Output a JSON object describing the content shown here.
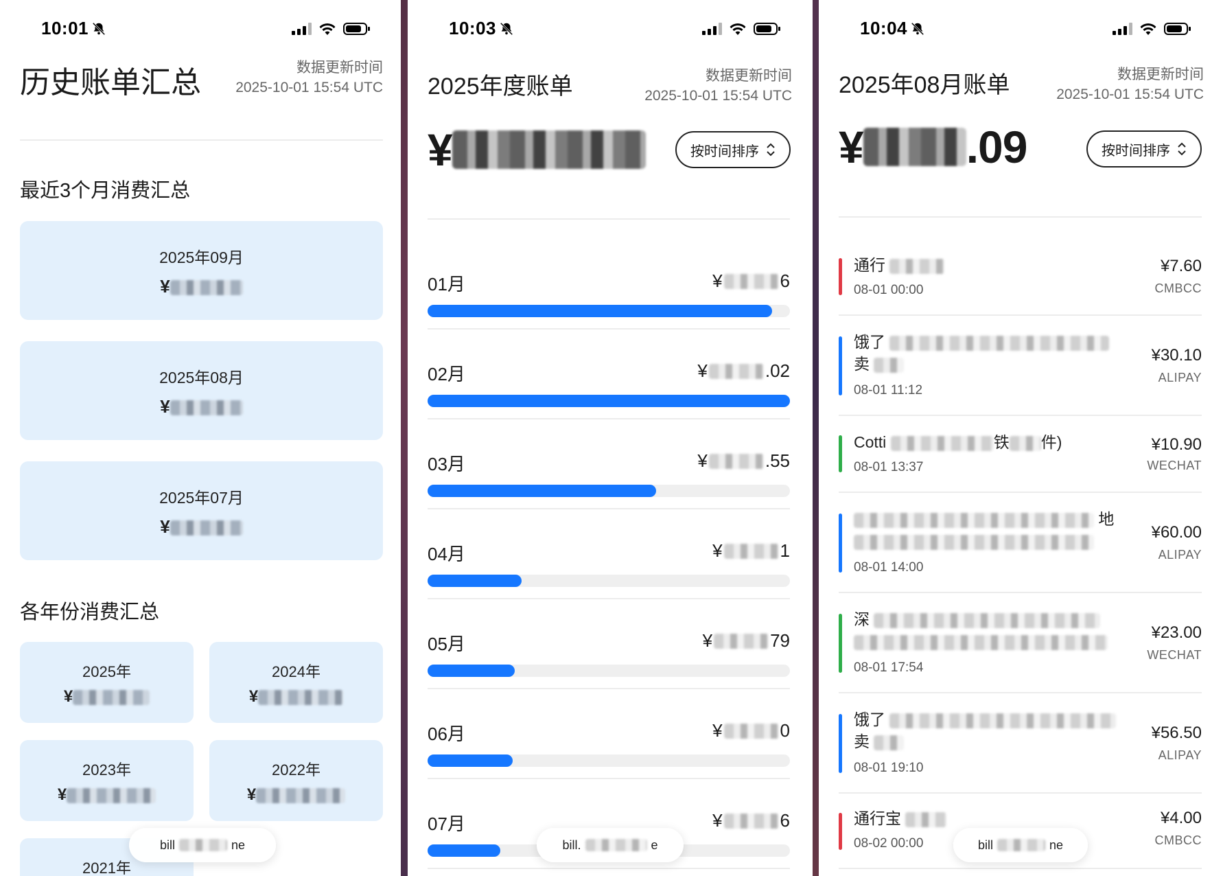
{
  "status": {
    "p1_time": "10:01",
    "p2_time": "10:03",
    "p3_time": "10:04"
  },
  "update": {
    "label": "数据更新时间",
    "value": "2025-10-01 15:54 UTC"
  },
  "summary": {
    "title": "历史账单汇总",
    "recent_title": "最近3个月消费汇总",
    "recent_months": [
      {
        "label": "2025年09月",
        "currency": "¥"
      },
      {
        "label": "2025年08月",
        "currency": "¥"
      },
      {
        "label": "2025年07月",
        "currency": "¥"
      }
    ],
    "yearly_title": "各年份消费汇总",
    "years": [
      {
        "label": "2025年",
        "currency": "¥"
      },
      {
        "label": "2024年",
        "currency": "¥"
      },
      {
        "label": "2023年",
        "currency": "¥"
      },
      {
        "label": "2022年",
        "currency": "¥"
      },
      {
        "label": "2021年"
      }
    ],
    "home_left": "bill",
    "home_right": "ne"
  },
  "annual": {
    "title": "2025年度账单",
    "currency": "¥",
    "sort_label": "按时间排序",
    "months": [
      {
        "label": "01月",
        "prefix": "¥",
        "suffix": "6",
        "fill": 0.95
      },
      {
        "label": "02月",
        "prefix": "¥",
        "suffix": ".02",
        "fill": 1.0
      },
      {
        "label": "03月",
        "prefix": "¥",
        "suffix": ".55",
        "fill": 0.63
      },
      {
        "label": "04月",
        "prefix": "¥",
        "suffix": "1",
        "fill": 0.26
      },
      {
        "label": "05月",
        "prefix": "¥",
        "suffix": "79",
        "fill": 0.24
      },
      {
        "label": "06月",
        "prefix": "¥",
        "suffix": "0",
        "fill": 0.235
      },
      {
        "label": "07月",
        "prefix": "¥",
        "suffix": "6",
        "fill": 0.2
      }
    ],
    "home_left": "bill.",
    "home_right": "e"
  },
  "monthly": {
    "title": "2025年08月账单",
    "currency": "¥",
    "amount_suffix": ".09",
    "sort_label": "按时间排序",
    "transactions": [
      {
        "name": "通行",
        "time": "08-01 00:00",
        "amount": "¥7.60",
        "source": "CMBCC",
        "color": "#e03a45"
      },
      {
        "name": "饿了",
        "name2": "卖",
        "time": "08-01 11:12",
        "amount": "¥30.10",
        "source": "ALIPAY",
        "color": "#1677ff"
      },
      {
        "name": "Cotti",
        "name_tail": "铁",
        "name_end": "件)",
        "time": "08-01 13:37",
        "amount": "¥10.90",
        "source": "WECHAT",
        "color": "#2fae4a"
      },
      {
        "name": "",
        "name_end": "地",
        "time": "08-01 14:00",
        "amount": "¥60.00",
        "source": "ALIPAY",
        "color": "#1677ff"
      },
      {
        "name": "深",
        "time": "08-01 17:54",
        "amount": "¥23.00",
        "source": "WECHAT",
        "color": "#2fae4a"
      },
      {
        "name": "饿了",
        "name2": "卖",
        "time": "08-01 19:10",
        "amount": "¥56.50",
        "source": "ALIPAY",
        "color": "#1677ff"
      },
      {
        "name": "通行宝",
        "time": "08-02 00:00",
        "amount": "¥4.00",
        "source": "CMBCC",
        "color": "#e03a45"
      }
    ],
    "home_left": "bill",
    "home_right": "ne"
  }
}
